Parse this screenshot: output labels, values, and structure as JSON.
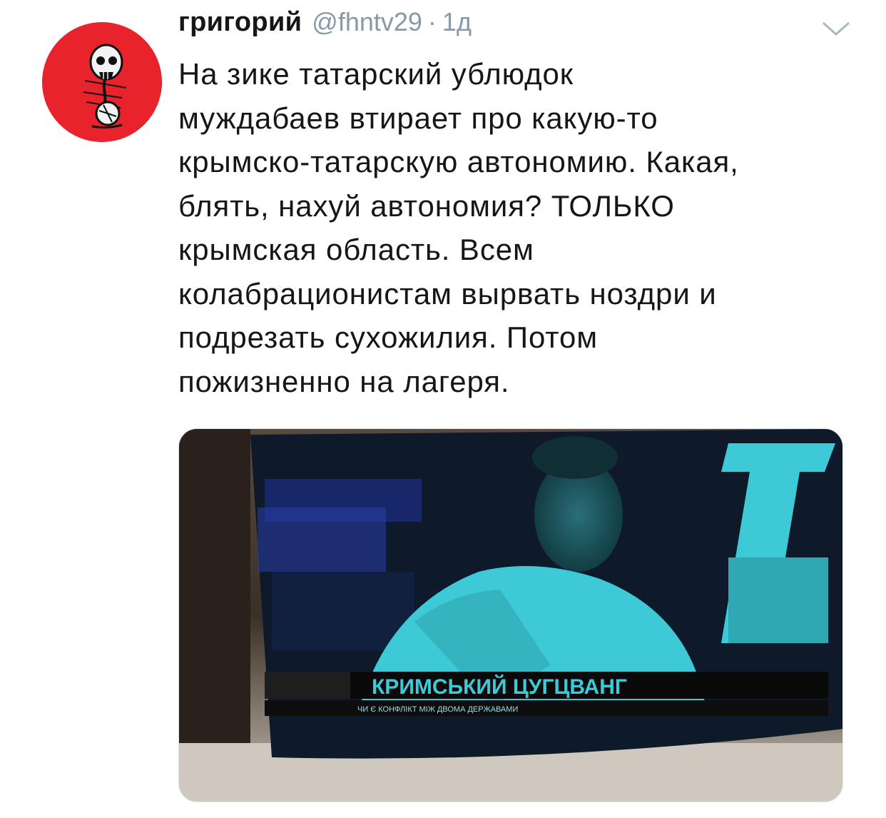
{
  "tweet": {
    "display_name": "григорий",
    "handle": "@fhntv29",
    "separator": "·",
    "timestamp": "1д",
    "text": "На зике татарский ублюдок\nмуждабаев втирает про какую-то\nкрымско-татарскую автономию. Какая,\nблять, нахуй автономия? ТОЛЬКО\nкрымская область. Всем\nколабрационистам вырвать ноздри и\nподрезать сухожилия. Потом\nпожизненно на лагеря.",
    "menu_icon": "chevron-down-icon",
    "avatar_icon": "skull-illustration",
    "media": {
      "caption_main": "КРИМСЬКИЙ ЦУГЦВАНГ",
      "ticker": "ЧИ Є КОНФЛІКТ МІЖ ДВОМА ДЕРЖАВАМИ"
    }
  },
  "colors": {
    "avatar_bg": "#e8232b",
    "name": "#14171a",
    "secondary": "#8899a6",
    "tv_screen": "#3ec9d6"
  }
}
